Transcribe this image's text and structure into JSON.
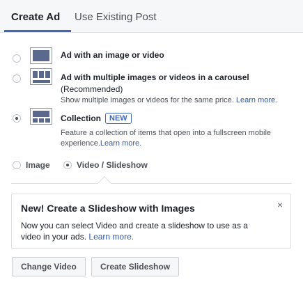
{
  "tabs": [
    {
      "label": "Create Ad",
      "active": true
    },
    {
      "label": "Use Existing Post",
      "active": false
    }
  ],
  "options": [
    {
      "title": "Ad with an image or video",
      "selected": false,
      "icon": "single-image-icon"
    },
    {
      "title": "Ad with multiple images or videos in a carousel",
      "subtitle": "(Recommended)",
      "description": "Show multiple images or videos for the same price.",
      "link": "Learn more.",
      "selected": false,
      "icon": "carousel-icon"
    },
    {
      "title": "Collection",
      "badge": "NEW",
      "description_line1": "Feature a collection of items that open into a fullscreen mobile",
      "description_line2": "experience.",
      "link": "Learn more.",
      "selected": true,
      "icon": "collection-icon"
    }
  ],
  "media_formats": [
    {
      "label": "Image",
      "selected": false
    },
    {
      "label": "Video / Slideshow",
      "selected": true
    }
  ],
  "callout": {
    "title": "New! Create a Slideshow with Images",
    "body_line1": "Now you can select Video and create a slideshow to use as a",
    "body_line2": "video in your ads.",
    "link": "Learn more.",
    "close": "×"
  },
  "buttons": {
    "change_video": "Change Video",
    "create_slideshow": "Create Slideshow"
  },
  "colors": {
    "accent": "#4267b2",
    "link": "#365899",
    "thumb_fill": "#5b6a8c"
  }
}
